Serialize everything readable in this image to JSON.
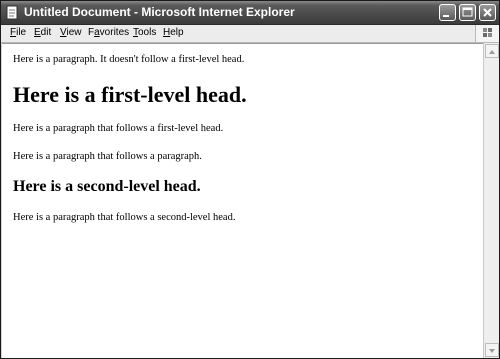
{
  "window": {
    "title": "Untitled Document - Microsoft Internet Explorer",
    "app_icon": "ie-page-icon",
    "controls": [
      {
        "name": "minimize-button",
        "icon": "minimize-icon"
      },
      {
        "name": "maximize-button",
        "icon": "maximize-icon"
      },
      {
        "name": "close-button",
        "icon": "close-icon"
      }
    ]
  },
  "menubar": {
    "items": [
      {
        "accel": "F",
        "rest": "ile"
      },
      {
        "accel": "E",
        "rest": "dit"
      },
      {
        "accel": "V",
        "rest": "iew"
      },
      {
        "pre": "F",
        "accel": "a",
        "rest": "vorites"
      },
      {
        "accel": "T",
        "rest": "ools"
      },
      {
        "accel": "H",
        "rest": "elp"
      }
    ],
    "logo_icon": "windows-flag-icon"
  },
  "document": {
    "p1": "Here is a paragraph. It doesn't follow a first-level head.",
    "h1": "Here is a first-level head.",
    "p2": "Here is a paragraph that follows a first-level head.",
    "p3": "Here is a paragraph that follows a paragraph.",
    "h2": "Here is a second-level head.",
    "p4": "Here is a paragraph that follows a second-level head."
  },
  "colors": {
    "titlebar": "#4a4a4a",
    "title_text": "#ffffff",
    "menubar": "#ececec",
    "content_bg": "#ffffff"
  }
}
